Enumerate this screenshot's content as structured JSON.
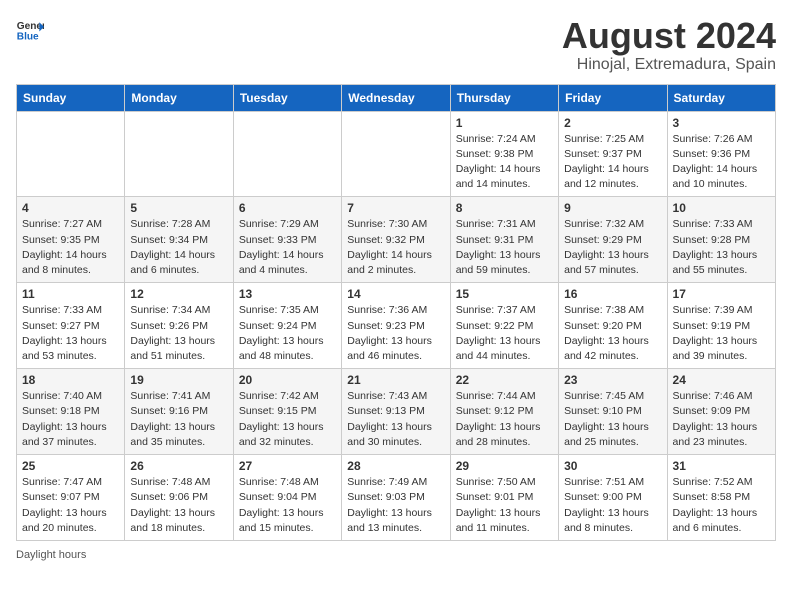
{
  "header": {
    "logo": {
      "general": "General",
      "blue": "Blue"
    },
    "title": "August 2024",
    "subtitle": "Hinojal, Extremadura, Spain"
  },
  "calendar": {
    "days_of_week": [
      "Sunday",
      "Monday",
      "Tuesday",
      "Wednesday",
      "Thursday",
      "Friday",
      "Saturday"
    ],
    "weeks": [
      [
        {
          "day": "",
          "sunrise": "",
          "sunset": "",
          "daylight": ""
        },
        {
          "day": "",
          "sunrise": "",
          "sunset": "",
          "daylight": ""
        },
        {
          "day": "",
          "sunrise": "",
          "sunset": "",
          "daylight": ""
        },
        {
          "day": "",
          "sunrise": "",
          "sunset": "",
          "daylight": ""
        },
        {
          "day": "1",
          "sunrise": "Sunrise: 7:24 AM",
          "sunset": "Sunset: 9:38 PM",
          "daylight": "Daylight: 14 hours and 14 minutes."
        },
        {
          "day": "2",
          "sunrise": "Sunrise: 7:25 AM",
          "sunset": "Sunset: 9:37 PM",
          "daylight": "Daylight: 14 hours and 12 minutes."
        },
        {
          "day": "3",
          "sunrise": "Sunrise: 7:26 AM",
          "sunset": "Sunset: 9:36 PM",
          "daylight": "Daylight: 14 hours and 10 minutes."
        }
      ],
      [
        {
          "day": "4",
          "sunrise": "Sunrise: 7:27 AM",
          "sunset": "Sunset: 9:35 PM",
          "daylight": "Daylight: 14 hours and 8 minutes."
        },
        {
          "day": "5",
          "sunrise": "Sunrise: 7:28 AM",
          "sunset": "Sunset: 9:34 PM",
          "daylight": "Daylight: 14 hours and 6 minutes."
        },
        {
          "day": "6",
          "sunrise": "Sunrise: 7:29 AM",
          "sunset": "Sunset: 9:33 PM",
          "daylight": "Daylight: 14 hours and 4 minutes."
        },
        {
          "day": "7",
          "sunrise": "Sunrise: 7:30 AM",
          "sunset": "Sunset: 9:32 PM",
          "daylight": "Daylight: 14 hours and 2 minutes."
        },
        {
          "day": "8",
          "sunrise": "Sunrise: 7:31 AM",
          "sunset": "Sunset: 9:31 PM",
          "daylight": "Daylight: 13 hours and 59 minutes."
        },
        {
          "day": "9",
          "sunrise": "Sunrise: 7:32 AM",
          "sunset": "Sunset: 9:29 PM",
          "daylight": "Daylight: 13 hours and 57 minutes."
        },
        {
          "day": "10",
          "sunrise": "Sunrise: 7:33 AM",
          "sunset": "Sunset: 9:28 PM",
          "daylight": "Daylight: 13 hours and 55 minutes."
        }
      ],
      [
        {
          "day": "11",
          "sunrise": "Sunrise: 7:33 AM",
          "sunset": "Sunset: 9:27 PM",
          "daylight": "Daylight: 13 hours and 53 minutes."
        },
        {
          "day": "12",
          "sunrise": "Sunrise: 7:34 AM",
          "sunset": "Sunset: 9:26 PM",
          "daylight": "Daylight: 13 hours and 51 minutes."
        },
        {
          "day": "13",
          "sunrise": "Sunrise: 7:35 AM",
          "sunset": "Sunset: 9:24 PM",
          "daylight": "Daylight: 13 hours and 48 minutes."
        },
        {
          "day": "14",
          "sunrise": "Sunrise: 7:36 AM",
          "sunset": "Sunset: 9:23 PM",
          "daylight": "Daylight: 13 hours and 46 minutes."
        },
        {
          "day": "15",
          "sunrise": "Sunrise: 7:37 AM",
          "sunset": "Sunset: 9:22 PM",
          "daylight": "Daylight: 13 hours and 44 minutes."
        },
        {
          "day": "16",
          "sunrise": "Sunrise: 7:38 AM",
          "sunset": "Sunset: 9:20 PM",
          "daylight": "Daylight: 13 hours and 42 minutes."
        },
        {
          "day": "17",
          "sunrise": "Sunrise: 7:39 AM",
          "sunset": "Sunset: 9:19 PM",
          "daylight": "Daylight: 13 hours and 39 minutes."
        }
      ],
      [
        {
          "day": "18",
          "sunrise": "Sunrise: 7:40 AM",
          "sunset": "Sunset: 9:18 PM",
          "daylight": "Daylight: 13 hours and 37 minutes."
        },
        {
          "day": "19",
          "sunrise": "Sunrise: 7:41 AM",
          "sunset": "Sunset: 9:16 PM",
          "daylight": "Daylight: 13 hours and 35 minutes."
        },
        {
          "day": "20",
          "sunrise": "Sunrise: 7:42 AM",
          "sunset": "Sunset: 9:15 PM",
          "daylight": "Daylight: 13 hours and 32 minutes."
        },
        {
          "day": "21",
          "sunrise": "Sunrise: 7:43 AM",
          "sunset": "Sunset: 9:13 PM",
          "daylight": "Daylight: 13 hours and 30 minutes."
        },
        {
          "day": "22",
          "sunrise": "Sunrise: 7:44 AM",
          "sunset": "Sunset: 9:12 PM",
          "daylight": "Daylight: 13 hours and 28 minutes."
        },
        {
          "day": "23",
          "sunrise": "Sunrise: 7:45 AM",
          "sunset": "Sunset: 9:10 PM",
          "daylight": "Daylight: 13 hours and 25 minutes."
        },
        {
          "day": "24",
          "sunrise": "Sunrise: 7:46 AM",
          "sunset": "Sunset: 9:09 PM",
          "daylight": "Daylight: 13 hours and 23 minutes."
        }
      ],
      [
        {
          "day": "25",
          "sunrise": "Sunrise: 7:47 AM",
          "sunset": "Sunset: 9:07 PM",
          "daylight": "Daylight: 13 hours and 20 minutes."
        },
        {
          "day": "26",
          "sunrise": "Sunrise: 7:48 AM",
          "sunset": "Sunset: 9:06 PM",
          "daylight": "Daylight: 13 hours and 18 minutes."
        },
        {
          "day": "27",
          "sunrise": "Sunrise: 7:48 AM",
          "sunset": "Sunset: 9:04 PM",
          "daylight": "Daylight: 13 hours and 15 minutes."
        },
        {
          "day": "28",
          "sunrise": "Sunrise: 7:49 AM",
          "sunset": "Sunset: 9:03 PM",
          "daylight": "Daylight: 13 hours and 13 minutes."
        },
        {
          "day": "29",
          "sunrise": "Sunrise: 7:50 AM",
          "sunset": "Sunset: 9:01 PM",
          "daylight": "Daylight: 13 hours and 11 minutes."
        },
        {
          "day": "30",
          "sunrise": "Sunrise: 7:51 AM",
          "sunset": "Sunset: 9:00 PM",
          "daylight": "Daylight: 13 hours and 8 minutes."
        },
        {
          "day": "31",
          "sunrise": "Sunrise: 7:52 AM",
          "sunset": "Sunset: 8:58 PM",
          "daylight": "Daylight: 13 hours and 6 minutes."
        }
      ]
    ]
  },
  "footer": {
    "daylight_label": "Daylight hours"
  }
}
